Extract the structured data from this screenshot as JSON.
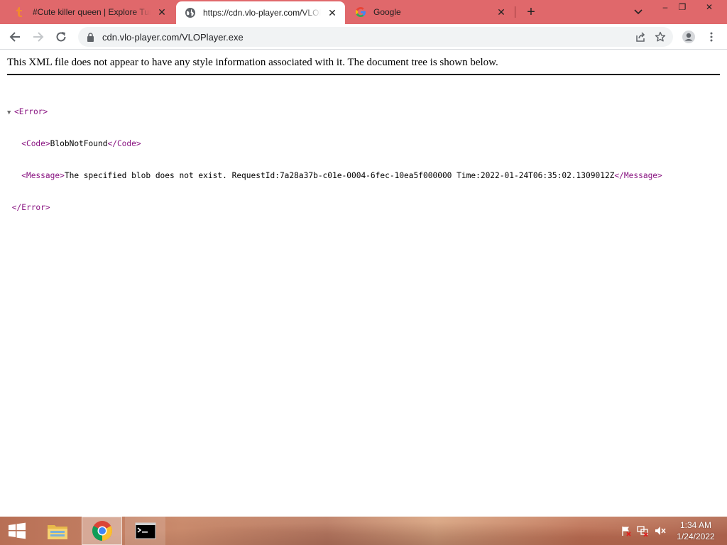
{
  "browser": {
    "tabs": [
      {
        "title": "#Cute killer queen | Explore Tumblr",
        "favicon": "tumblr-icon",
        "active": false
      },
      {
        "title": "https://cdn.vlo-player.com/VLOPlayer.exe",
        "favicon": "globe-icon",
        "active": true
      },
      {
        "title": "Google",
        "favicon": "google-icon",
        "active": false
      }
    ],
    "new_tab_label": "+",
    "window_controls": {
      "minimize": "–",
      "restore": "❐",
      "close": "✕"
    },
    "address": "cdn.vlo-player.com/VLOPlayer.exe"
  },
  "page": {
    "xml_notice": "This XML file does not appear to have any style information associated with it. The document tree is shown below.",
    "tree": {
      "error_open": "<Error>",
      "code_open": "<Code>",
      "code_value": "BlobNotFound",
      "code_close": "</Code>",
      "message_open": "<Message>",
      "message_value": "The specified blob does not exist. RequestId:7a28a37b-c01e-0004-6fec-10ea5f000000 Time:2022-01-24T06:35:02.1309012Z",
      "message_close": "</Message>",
      "error_close": "</Error>"
    }
  },
  "taskbar": {
    "time": "1:34 AM",
    "date": "1/24/2022"
  },
  "colors": {
    "tabstrip": "#e0686b",
    "xml_tag": "#881280",
    "omnibox_bg": "#f1f3f4"
  }
}
